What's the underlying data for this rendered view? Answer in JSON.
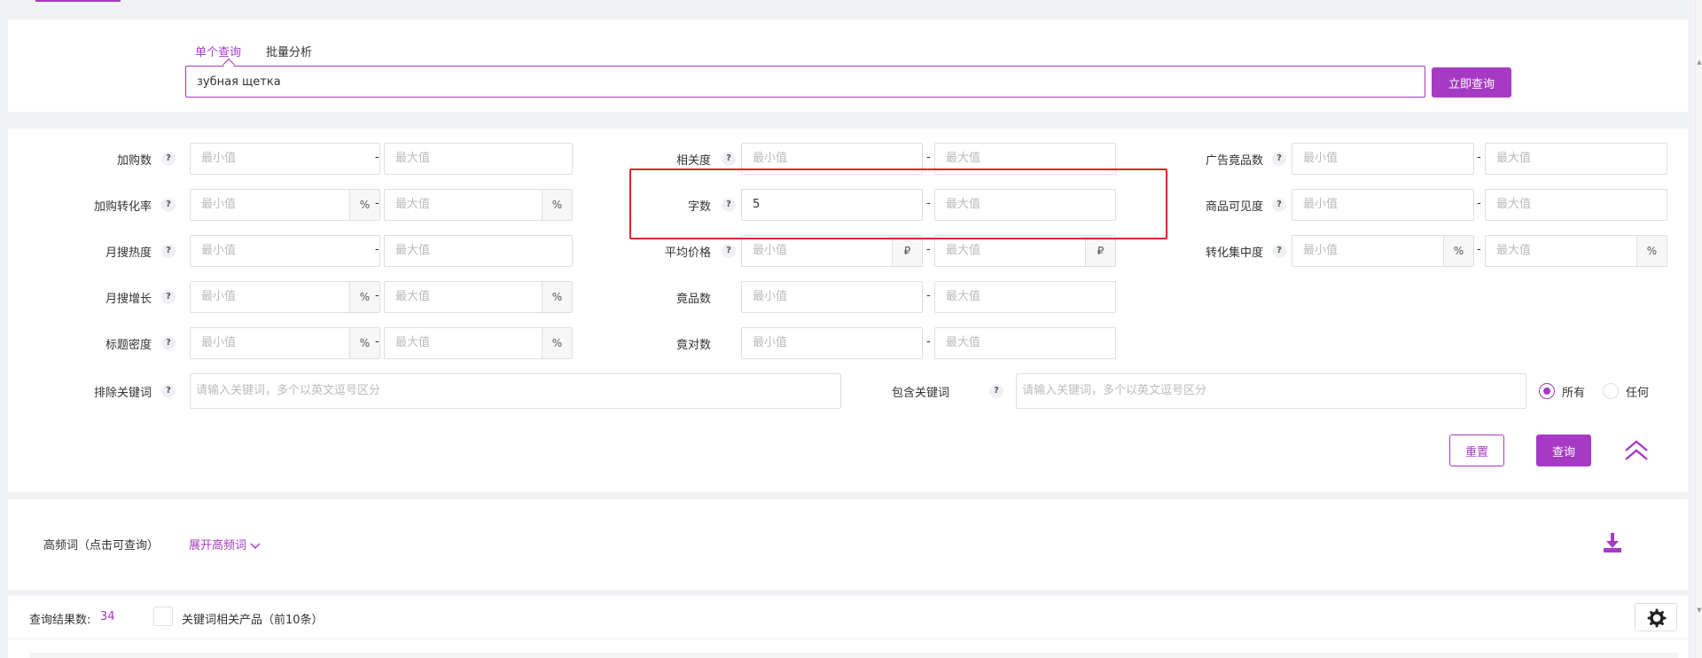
{
  "search": {
    "tabs": [
      {
        "label": "单个查询",
        "active": true
      },
      {
        "label": "批量分析",
        "active": false
      }
    ],
    "query_value": "зубная щетка",
    "submit_label": "立即查询"
  },
  "filters": {
    "min_placeholder": "最小值",
    "max_placeholder": "最大值",
    "col1": [
      {
        "label": "加购数",
        "unit": ""
      },
      {
        "label": "加购转化率",
        "unit": "%"
      },
      {
        "label": "月搜热度",
        "unit": ""
      },
      {
        "label": "月搜增长",
        "unit": "%"
      },
      {
        "label": "标题密度",
        "unit": "%"
      }
    ],
    "col2": [
      {
        "label": "相关度",
        "unit": "",
        "min_value": ""
      },
      {
        "label": "字数",
        "unit": "",
        "min_value": "5"
      },
      {
        "label": "平均价格",
        "unit": "₽",
        "min_value": ""
      },
      {
        "label": "竟品数",
        "unit": "",
        "min_value": ""
      },
      {
        "label": "竟对数",
        "unit": "",
        "min_value": ""
      }
    ],
    "col3": [
      {
        "label": "广告竟品数",
        "unit": ""
      },
      {
        "label": "商品可见度",
        "unit": ""
      },
      {
        "label": "转化集中度",
        "unit": "%"
      }
    ],
    "exclude": {
      "label": "排除关键词",
      "placeholder": "请输入关键词，多个以英文逗号区分"
    },
    "include": {
      "label": "包含关键词",
      "placeholder": "请输入关键词，多个以英文逗号区分"
    },
    "match_options": [
      {
        "label": "所有",
        "checked": true
      },
      {
        "label": "任何",
        "checked": false
      }
    ],
    "help_glyph": "?",
    "reset_label": "重置",
    "query_label": "查询",
    "colors": {
      "accent": "#a63ac4",
      "highlight": "#e0262a"
    }
  },
  "high_freq": {
    "label": "高频词（点击可查询）",
    "expand_label": "展开高频词"
  },
  "results": {
    "count_label": "查询结果数:",
    "count": "34",
    "related_label": "关键词相关产品（前10条）"
  }
}
